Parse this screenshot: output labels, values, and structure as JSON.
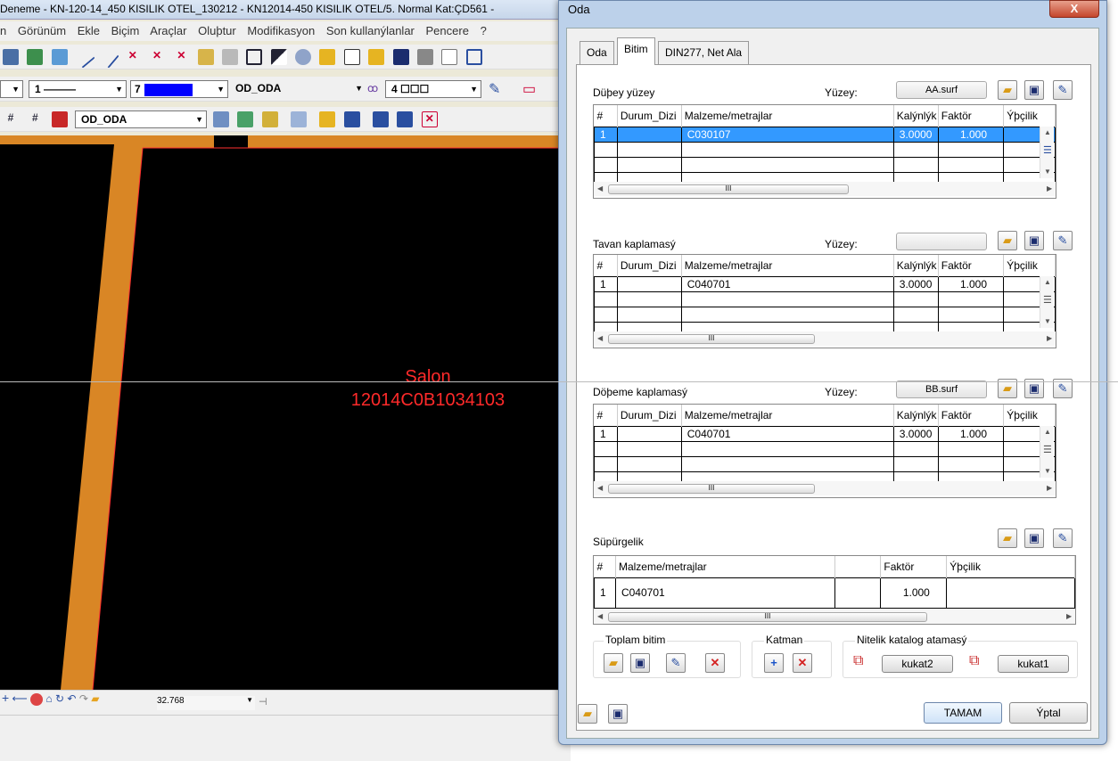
{
  "app": {
    "title": "Deneme - KN-120-14_450 KISILIK OTEL_130212 - KN12014-450 KISILIK OTEL/5. Normal Kat:ÇD561 -",
    "menu": [
      "n",
      "Görünüm",
      "Ekle",
      "Biçim",
      "Araçlar",
      "Oluþtur",
      "Modifikasyon",
      "Son kullanýlanlar",
      "Pencere",
      "?"
    ],
    "toolbar2": {
      "linetype": "1",
      "color": "7",
      "layer": "OD_ODA",
      "width": "4"
    },
    "toolbar3": {
      "layer": "OD_ODA"
    },
    "canvas": {
      "room_name": "Salon",
      "room_code": "12014C0B1034103"
    },
    "zoom": "32.768"
  },
  "dialog": {
    "title": "Oda",
    "close": "X",
    "tabs": [
      "Oda",
      "Bitim",
      "DIN277, Net Ala"
    ],
    "active_tab": "Bitim",
    "sections": [
      {
        "label": "Düþey yüzey",
        "surface_label": "Yüzey:",
        "surface": "AA.surf",
        "columns": [
          "#",
          "Durum_Dizi",
          "Malzeme/metrajlar",
          "Kalýnlýk",
          "Faktör",
          "Ýþçilik"
        ],
        "rows": [
          [
            "1",
            "",
            "C030107",
            "3.0000",
            "1.000",
            ""
          ]
        ]
      },
      {
        "label": "Tavan kaplamasý",
        "surface_label": "Yüzey:",
        "surface": "",
        "columns": [
          "#",
          "Durum_Dizi",
          "Malzeme/metrajlar",
          "Kalýnlýk",
          "Faktör",
          "Ýþçilik"
        ],
        "rows": [
          [
            "1",
            "",
            "C040701",
            "3.0000",
            "1.000",
            ""
          ]
        ]
      },
      {
        "label": "Döþeme kaplamasý",
        "surface_label": "Yüzey:",
        "surface": "BB.surf",
        "columns": [
          "#",
          "Durum_Dizi",
          "Malzeme/metrajlar",
          "Kalýnlýk",
          "Faktör",
          "Ýþçilik"
        ],
        "rows": [
          [
            "1",
            "",
            "C040701",
            "3.0000",
            "1.000",
            ""
          ]
        ]
      }
    ],
    "supurgelik": {
      "label": "Süpürgelik",
      "columns": [
        "#",
        "Malzeme/metrajlar",
        "",
        "Faktör",
        "Ýþçilik"
      ],
      "rows": [
        [
          "1",
          "C040701",
          "",
          "1.000",
          ""
        ]
      ]
    },
    "groups": {
      "toplam": "Toplam bitim",
      "katman": "Katman",
      "nitelik": "Nitelik katalog atamasý",
      "kukat2": "kukat2",
      "kukat1": "kukat1"
    },
    "ok": "TAMAM",
    "cancel": "Ýptal",
    "scroll_glyph": "III"
  }
}
